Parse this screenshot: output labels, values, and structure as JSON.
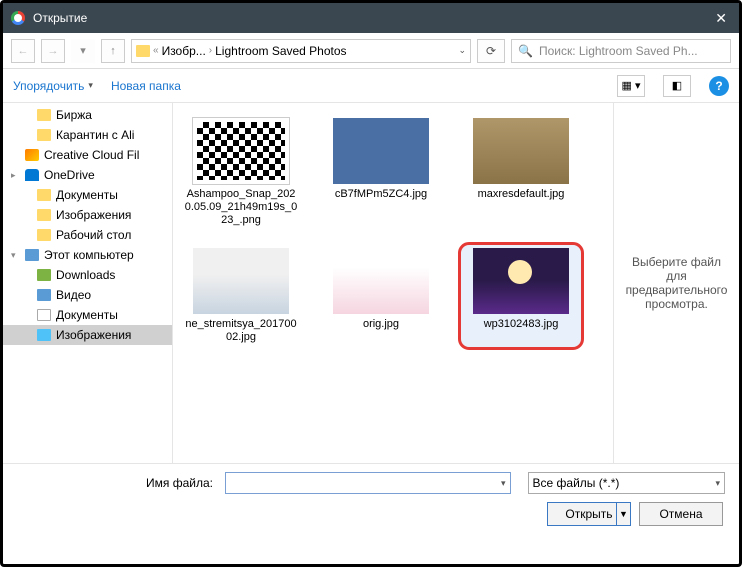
{
  "title": "Открытие",
  "breadcrumb": {
    "part1": "Изобр...",
    "part2": "Lightroom Saved Photos"
  },
  "search_placeholder": "Поиск: Lightroom Saved Ph...",
  "toolbar": {
    "organize": "Упорядочить",
    "newfolder": "Новая папка"
  },
  "sidebar": {
    "items": [
      {
        "label": "Биржа",
        "icon": "ic",
        "lvl": 1
      },
      {
        "label": "Карантин с Ali",
        "icon": "ic",
        "lvl": 1
      },
      {
        "label": "Creative Cloud Fil",
        "icon": "ic cc",
        "lvl": 0
      },
      {
        "label": "OneDrive",
        "icon": "ic od",
        "lvl": 0,
        "arrow": "▸"
      },
      {
        "label": "Документы",
        "icon": "ic",
        "lvl": 1
      },
      {
        "label": "Изображения",
        "icon": "ic",
        "lvl": 1
      },
      {
        "label": "Рабочий стол",
        "icon": "ic",
        "lvl": 1
      },
      {
        "label": "Этот компьютер",
        "icon": "ic pc",
        "lvl": 0,
        "arrow": "▾"
      },
      {
        "label": "Downloads",
        "icon": "ic dl",
        "lvl": 1
      },
      {
        "label": "Видео",
        "icon": "ic vid",
        "lvl": 1
      },
      {
        "label": "Документы",
        "icon": "ic doc",
        "lvl": 1
      },
      {
        "label": "Изображения",
        "icon": "ic img",
        "lvl": 1,
        "sel": true
      }
    ]
  },
  "files": [
    {
      "name": "Ashampoo_Snap_2020.05.09_21h49m19s_023_.png",
      "cls": "qr"
    },
    {
      "name": "cB7fMPm5ZC4.jpg",
      "cls": "blue"
    },
    {
      "name": "maxresdefault.jpg",
      "cls": "sepia"
    },
    {
      "name": "ne_stremitsya_20170002.jpg",
      "cls": "man"
    },
    {
      "name": "orig.jpg",
      "cls": "girl"
    },
    {
      "name": "wp3102483.jpg",
      "cls": "synth",
      "selected": true
    }
  ],
  "preview_text": "Выберите файл для предварительного просмотра.",
  "footer": {
    "filename_label": "Имя файла:",
    "filename_value": "",
    "filetype": "Все файлы (*.*)",
    "open": "Открыть",
    "cancel": "Отмена"
  }
}
